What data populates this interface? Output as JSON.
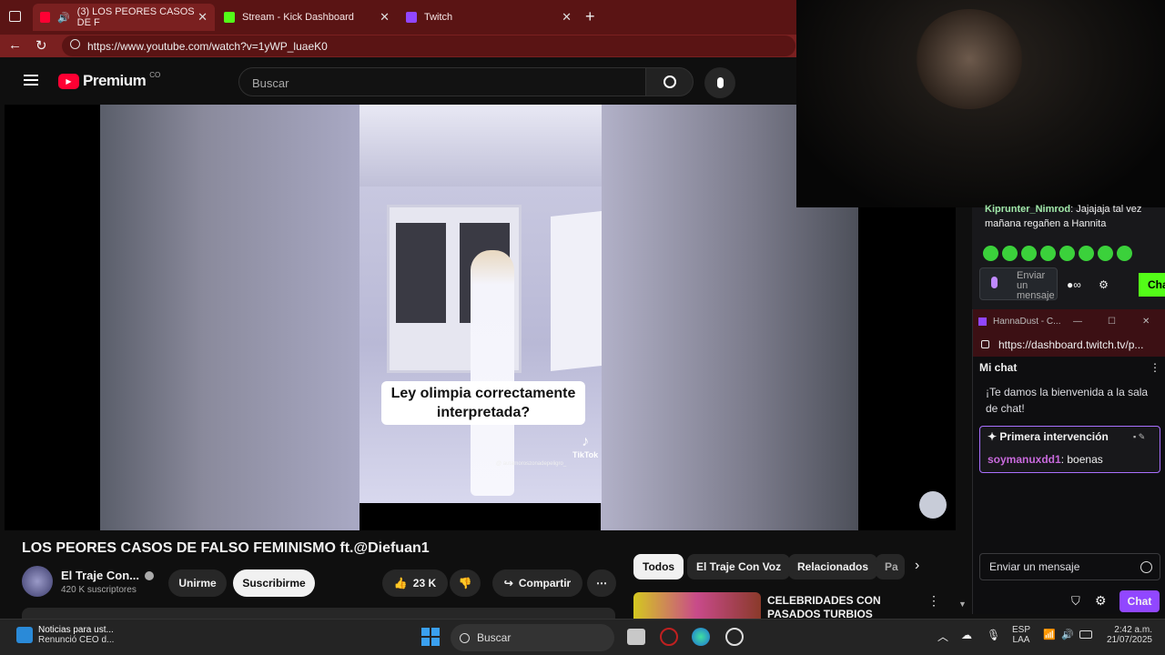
{
  "browser": {
    "tabs": [
      {
        "label": "(3) LOS PEORES CASOS DE F",
        "color": "#ff0033"
      },
      {
        "label": "Stream - Kick Dashboard",
        "color": "#53fc18"
      },
      {
        "label": "Twitch",
        "color": "#9146ff"
      }
    ],
    "url": "https://www.youtube.com/watch?v=1yWP_luaeK0"
  },
  "youtube": {
    "logo_text": "Premium",
    "country": "CO",
    "search_placeholder": "Buscar",
    "video_caption": "Ley olimpia correctamente interpretada?",
    "tiktok_label": "TikTok",
    "tiktok_handle": "@ autamoroszonadepeligro_",
    "title": "LOS PEORES CASOS DE FALSO FEMINISMO ft.@Diefuan1",
    "channel_name": "El Traje Con...",
    "subscribers": "420 K suscriptores",
    "join_label": "Unirme",
    "subscribe_label": "Suscribirme",
    "likes": "23 K",
    "share_label": "Compartir",
    "chips": [
      "Todos",
      "El Traje Con Voz",
      "Relacionados",
      "Pa"
    ],
    "rec_title": "CELEBRIDADES CON PASADOS TURBIOS"
  },
  "chat_top": {
    "user": "Kiprunter_Nimrod",
    "message": ": Jajajaja tal vez mañana regañen a Hannita",
    "input_text": "Enviar un mensaje",
    "chat_button": "Cha"
  },
  "twitch_popup": {
    "window_title": "HannaDust - C...",
    "url": "https://dashboard.twitch.tv/p...",
    "header": "Mi chat",
    "welcome": "¡Te damos la bienvenida a la sala de chat!",
    "first_label": "Primera intervención",
    "first_user": "soymanuxdd1",
    "first_msg": ": boenas",
    "input_placeholder": "Enviar un mensaje",
    "chat_button": "Chat"
  },
  "taskbar": {
    "news_title": "Noticias para ust...",
    "news_sub": "Renunció CEO d...",
    "search_label": "Buscar",
    "lang1": "ESP",
    "lang2": "LAA",
    "time": "2:42 a.m.",
    "date": "21/07/2025"
  }
}
